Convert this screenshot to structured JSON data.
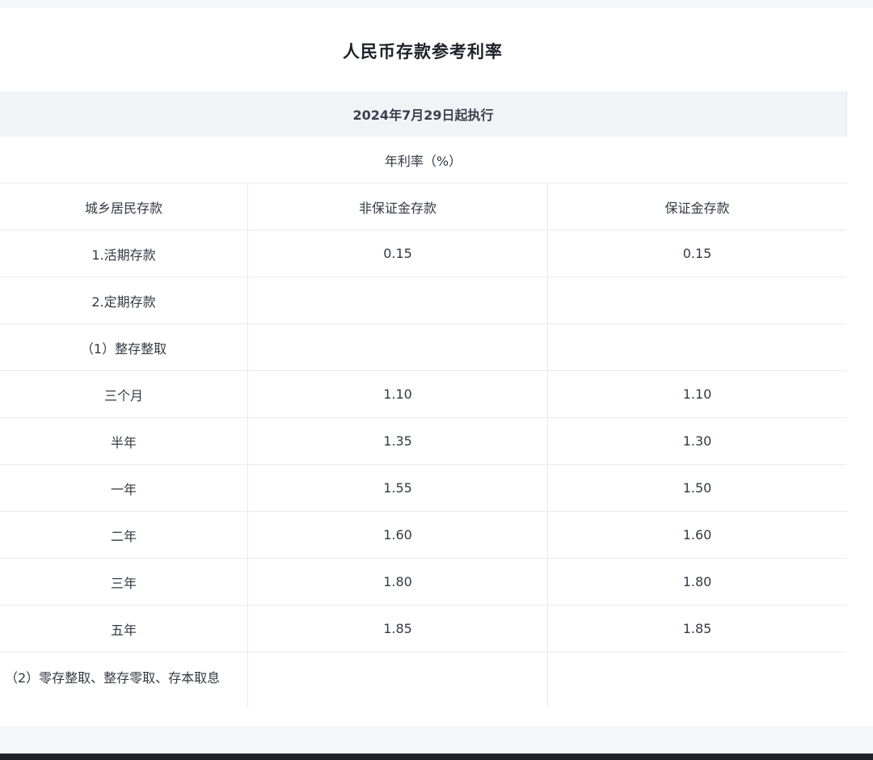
{
  "title": "人民币存款参考利率",
  "effective_date": "2024年7月29日起执行",
  "unit_label": "年利率（%）",
  "columns": {
    "category": "城乡居民存款",
    "non_margin": "非保证金存款",
    "margin": "保证金存款"
  },
  "rows": [
    {
      "label": "1.活期存款",
      "non_margin": "0.15",
      "margin": "0.15"
    },
    {
      "label": "2.定期存款",
      "non_margin": "",
      "margin": ""
    },
    {
      "label": "（1）整存整取",
      "non_margin": "",
      "margin": ""
    },
    {
      "label": "三个月",
      "non_margin": "1.10",
      "margin": "1.10"
    },
    {
      "label": "半年",
      "non_margin": "1.35",
      "margin": "1.30"
    },
    {
      "label": "一年",
      "non_margin": "1.55",
      "margin": "1.50"
    },
    {
      "label": "二年",
      "non_margin": "1.60",
      "margin": "1.60"
    },
    {
      "label": "三年",
      "non_margin": "1.80",
      "margin": "1.80"
    },
    {
      "label": "五年",
      "non_margin": "1.85",
      "margin": "1.85"
    },
    {
      "label": "（2）零存整取、整存零取、存本取息",
      "non_margin": "",
      "margin": ""
    }
  ]
}
